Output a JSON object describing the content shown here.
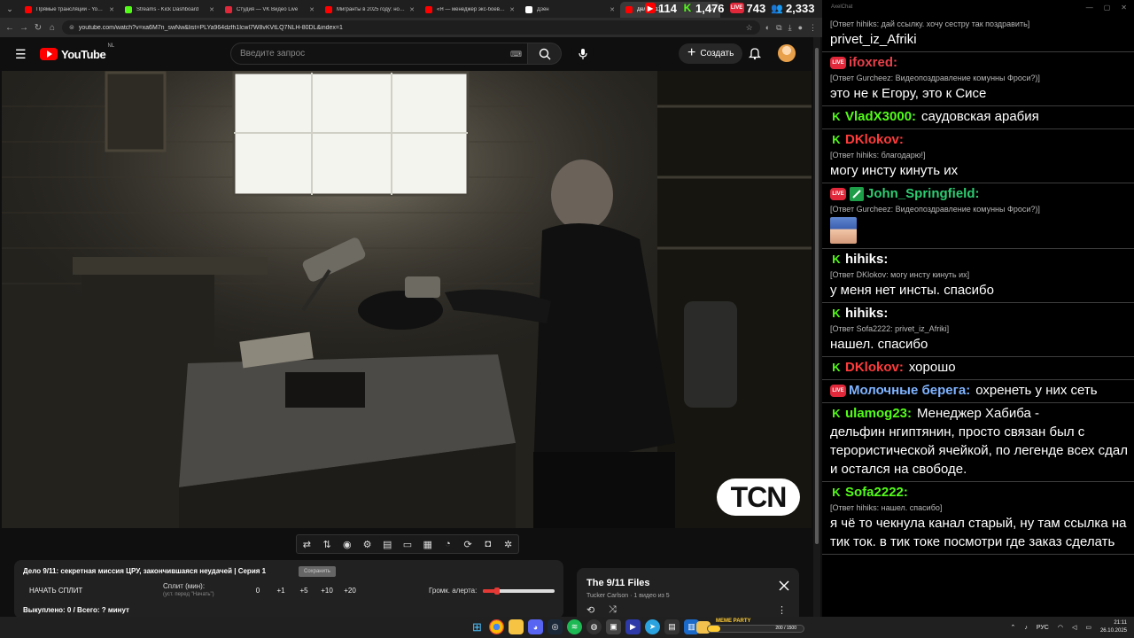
{
  "browser": {
    "tabs": [
      {
        "title": "Прямые трансляции - YouTube",
        "color": "#ff0000"
      },
      {
        "title": "Streams - Kick Dashboard",
        "color": "#53fc18"
      },
      {
        "title": "Студия — VK Видео Live",
        "color": "#e0283a"
      },
      {
        "title": "Мигранты в 2025 году: нов...",
        "color": "#ff0000"
      },
      {
        "title": "«Я — менеджер экс-боевика...",
        "color": "#ff0000"
      },
      {
        "title": "Дзен",
        "color": "#ffffff"
      },
      {
        "title": "Дело 9/11",
        "color": "#ff0000"
      }
    ],
    "url": "youtube.com/watch?v=xa6M7n_swNw&list=PLYa964dzfh1lcwl7W8vKVtLQ7NLH-80DL&index=1"
  },
  "stream_stats": {
    "youtube_viewers": "114",
    "kick_viewers": "1,476",
    "vk_viewers": "743",
    "total_viewers": "2,333"
  },
  "youtube": {
    "logo_text": "YouTube",
    "region": "NL",
    "search_placeholder": "Введите запрос",
    "create_label": "Создать"
  },
  "video": {
    "watermark": "TCN"
  },
  "extension": {
    "title": "Дело 9/11: секретная миссия ЦРУ, закончившаяся неудачей | Серия 1",
    "save_label": "Сохранить",
    "start_split": "НАЧАТЬ СПЛИТ",
    "split_label": "Сплит (мин):",
    "split_hint": "(уст. перед \"Начать\")",
    "values": [
      "0",
      "+1",
      "+5",
      "+10",
      "+20"
    ],
    "alert_label": "Громк. алерта:",
    "alert_level": 0.2,
    "totals": "Выкуплено: 0 / Всего: ? минут"
  },
  "playlist": {
    "title": "The 9/11 Files",
    "subtitle": "Tucker Carlson · 1 видео из 5"
  },
  "chat": {
    "window_title": "AxelChat",
    "kick_color": "#53fc18",
    "live_color": "#e0283a",
    "messages": [
      {
        "reply": "[Ответ hihiks: дай ссылку. хочу сестру так поздравить]",
        "text": "privet_iz_Afriki"
      },
      {
        "badges": [
          "live"
        ],
        "user": "ifoxred:",
        "user_color": "#e8404a",
        "reply": "[Ответ Gurcheez: Видеопоздравление комунны Фроси?)]",
        "text": "это не к Егору, это к Сисе"
      },
      {
        "badges": [
          "kick"
        ],
        "user": "VladX3000:",
        "user_color": "#53fc18",
        "inline": "саудовская арабия"
      },
      {
        "badges": [
          "kick"
        ],
        "user": "DKlokov:",
        "user_color": "#ff3b3b",
        "reply": "[Ответ hihiks: благодарю!]",
        "text": "могу инсту кинуть их"
      },
      {
        "badges": [
          "live",
          "mod"
        ],
        "user": "John_Springfield:",
        "user_color": "#2ecc71",
        "reply": "[Ответ Gurcheez: Видеопоздравление комунны Фроси?)]",
        "emote": true
      },
      {
        "badges": [
          "kick"
        ],
        "user": "hihiks:",
        "user_color": "#ffffff",
        "reply": "[Ответ DKlokov: могу инсту кинуть их]",
        "text": "у меня нет инсты. спасибо"
      },
      {
        "badges": [
          "kick"
        ],
        "user": "hihiks:",
        "user_color": "#ffffff",
        "reply": "[Ответ Sofa2222: privet_iz_Afriki]",
        "text": "нашел. спасибо"
      },
      {
        "badges": [
          "kick"
        ],
        "user": "DKlokov:",
        "user_color": "#ff3b3b",
        "inline": "хорошо"
      },
      {
        "badges": [
          "live"
        ],
        "user": "Молочные берега:",
        "user_color": "#7fb3ff",
        "inline": "охренеть у них сеть"
      },
      {
        "badges": [
          "kick"
        ],
        "user": "ulamog23:",
        "user_color": "#53fc18",
        "inline": "Менеджер Хабиба -",
        "text": "дельфин нгиптянин, просто связан был с терористической ячейкой, по легенде всех сдал и остался на свободе."
      },
      {
        "badges": [
          "kick"
        ],
        "user": "Sofa2222:",
        "user_color": "#53fc18",
        "reply": "[Ответ hihiks: нашел. спасибо]",
        "text": "я чё то чекнула канал старый, ну там ссылка на тик ток. в тик токе посмотри где заказ сделать"
      }
    ]
  },
  "taskbar": {
    "widget_label": "MEME PARTY",
    "widget_progress": "200 / 1500",
    "widget_level": 0.133,
    "lang": "РУС",
    "time": "21:11",
    "date": "26.10.2025"
  }
}
